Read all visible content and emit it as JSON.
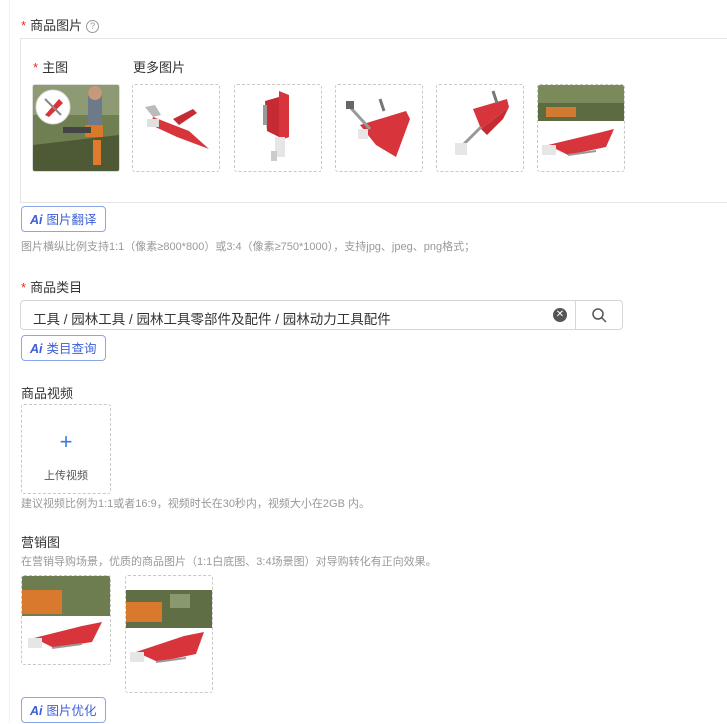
{
  "product_images": {
    "label": "商品图片",
    "help_icon": "question-circle-icon",
    "main_label": "主图",
    "more_label": "更多图片",
    "translate_btn": {
      "ai": "Ai",
      "label": "图片翻译"
    },
    "hint": "图片横纵比例支持1:1（像素≥800*800）或3:4（像素≥750*1000），支持jpg、jpeg、png格式；"
  },
  "category": {
    "label": "商品类目",
    "value": "工具 / 园林工具 / 园林工具零部件及配件 / 园林动力工具配件",
    "clear_icon": "clear-circle-icon",
    "search_icon": "search-icon",
    "query_btn": {
      "ai": "Ai",
      "label": "类目查询"
    }
  },
  "video": {
    "label": "商品视频",
    "upload_label": "上传视频",
    "plus_icon": "plus-icon",
    "hint": "建议视频比例为1:1或者16:9，视频时长在30秒内，视频大小在2GB 内。"
  },
  "marketing": {
    "label": "营销图",
    "hint": "在营销导购场景，优质的商品图片（1:1白底图、3:4场景图）对导购转化有正向效果。",
    "optimize_btn": {
      "ai": "Ai",
      "label": "图片优化"
    }
  },
  "colors": {
    "required": "#e0301e",
    "accent": "#3c5fd8",
    "product_red": "#d8343c"
  }
}
